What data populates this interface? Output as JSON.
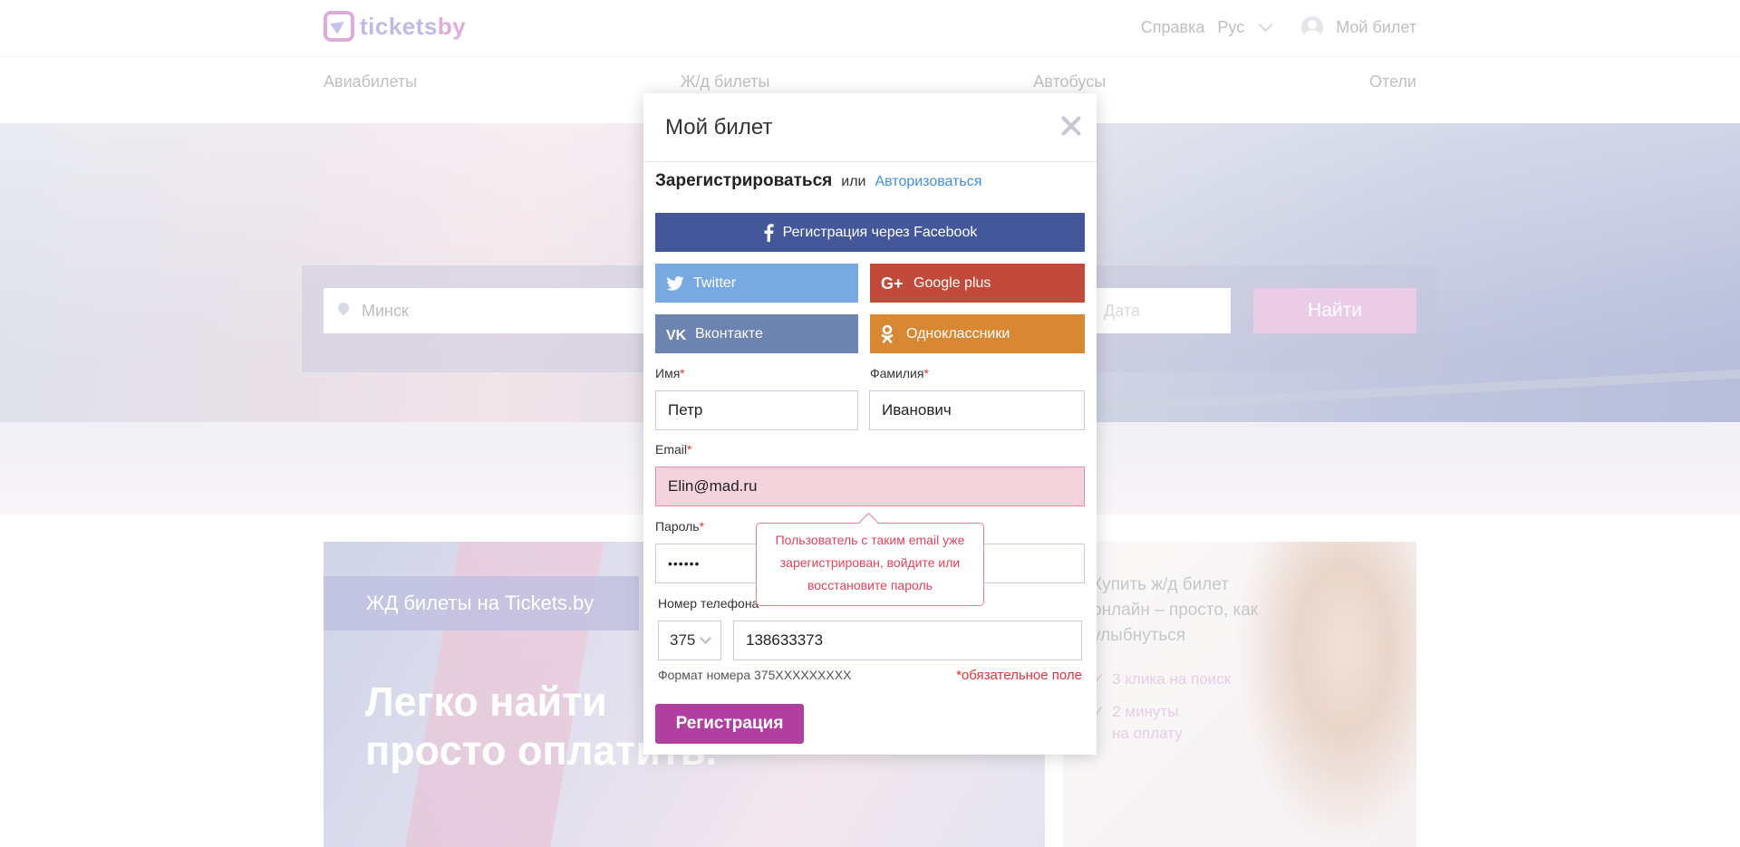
{
  "header": {
    "logo_text_main": "tickets",
    "logo_text_accent": "by",
    "help": "Справка",
    "language": "Рус",
    "account": "Мой билет"
  },
  "nav": {
    "items": [
      "Авиабилеты",
      "Ж/д билеты",
      "Автобусы",
      "Отели"
    ]
  },
  "search": {
    "from_value": "Минск",
    "date_placeholder": "Дата",
    "find_label": "Найти"
  },
  "promo": {
    "tag": "ЖД билеты на Tickets.by",
    "headline_line1": "Легко найти",
    "headline_line2": "просто оплатить.",
    "side_text": "Купить ж/д билет онлайн – просто, как улыбнуться",
    "side_item1": "3 клика на поиск",
    "side_item2_line1": "2 минуты",
    "side_item2_line2": "на оплату"
  },
  "modal": {
    "title": "Мой билет",
    "register_label": "Зарегистрироваться",
    "or_label": "или",
    "login_link": "Авторизоваться",
    "social": {
      "facebook": "Регистрация через Facebook",
      "twitter": "Twitter",
      "google": "Google plus",
      "vk": "Вконтакте",
      "ok": "Одноклассники"
    },
    "fields": {
      "first_name_label": "Имя",
      "first_name_value": "Петр",
      "last_name_label": "Фамилия",
      "last_name_value": "Иванович",
      "email_label": "Email",
      "email_value": "Elin@mad.ru",
      "password_label": "Пароль",
      "password_value": "••••••",
      "phone_label": "Номер телефона",
      "country_code": "375",
      "phone_value": "138633373",
      "required_mark": "*"
    },
    "error_tooltip": "Пользователь с таким email уже зарегистрирован, войдите или восстановите пароль",
    "phone_hint": "Формат номера 375XXXXXXXXX",
    "required_note": "*обязательное поле",
    "submit_label": "Регистрация"
  },
  "colors": {
    "brand_purple": "#b03fa0",
    "facebook": "#44579a",
    "twitter": "#78a9e0",
    "google": "#c24a3a",
    "vk": "#6e84b0",
    "ok": "#d88733",
    "error": "#e2323c",
    "link": "#3e8fdc"
  }
}
